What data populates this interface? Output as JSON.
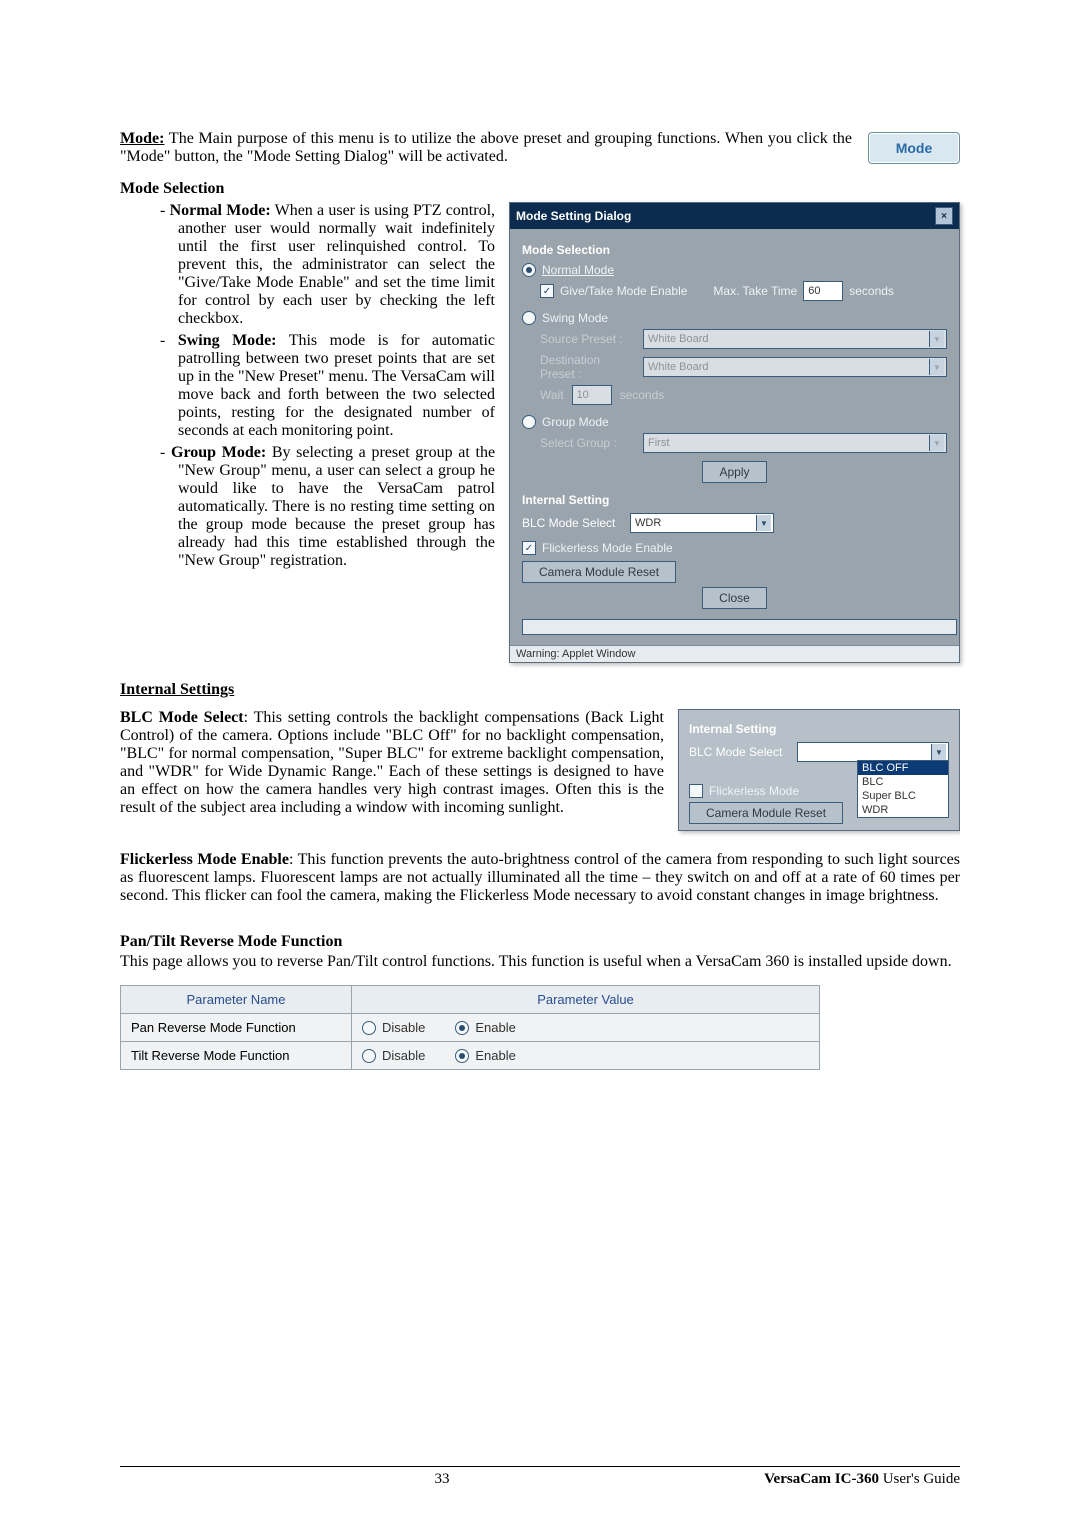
{
  "header": {
    "mode_label": "Mode:",
    "mode_paragraph": "The Main purpose of this menu is to utilize the above preset and grouping functions.   When you click the \"Mode\" button, the \"Mode Setting Dialog\" will be activated.",
    "mode_button": "Mode"
  },
  "mode_selection": {
    "title": "Mode Selection",
    "items": [
      {
        "name": "Normal Mode:",
        "text": "When a user is using PTZ control, another user would normally wait indefinitely until the first user relinquished control.  To prevent this, the administrator can select the \"Give/Take Mode Enable\" and set the time limit for control by each user by checking the left checkbox."
      },
      {
        "name": "Swing Mode:",
        "text": "This mode is for automatic patrolling between two preset points that are set up in the \"New Preset\" menu.   The VersaCam will move back and forth between the two selected points, resting for the designated number of seconds at each monitoring point."
      },
      {
        "name": "Group Mode:",
        "text": "By selecting a preset group at the \"New Group\" menu, a user can select a group he would like to have the VersaCam patrol automatically.   There is no resting time setting on the group mode because the preset group has already had this time established through the \"New Group\" registration."
      }
    ]
  },
  "dialog": {
    "title": "Mode Setting Dialog",
    "mode_selection_label": "Mode Selection",
    "normal_mode_label": "Normal Mode",
    "give_take_label": "Give/Take Mode Enable",
    "max_take_time_label": "Max. Take Time",
    "max_take_time_value": "60",
    "seconds_label": "seconds",
    "swing_mode_label": "Swing Mode",
    "source_preset_label": "Source Preset :",
    "source_preset_value": "White Board",
    "dest_preset_label": "Destination Preset :",
    "dest_preset_value": "White Board",
    "wait_label": "Wait",
    "wait_value": "10",
    "wait_seconds": "seconds",
    "group_mode_label": "Group Mode",
    "select_group_label": "Select Group :",
    "select_group_value": "First",
    "apply_label": "Apply",
    "internal_setting_label": "Internal Setting",
    "blc_mode_label": "BLC Mode Select",
    "blc_mode_value": "WDR",
    "flickerless_label": "Flickerless Mode Enable",
    "camera_reset_label": "Camera Module Reset",
    "close_label": "Close",
    "statusbar": "Warning: Applet Window"
  },
  "internal_settings": {
    "title": "Internal Settings",
    "blc": {
      "label": "BLC Mode Select",
      "text": ":   This setting controls the backlight compensations (Back Light Control) of the camera.   Options include \"BLC Off\" for no backlight compensation, \"BLC\" for normal compensation, \"Super BLC\" for extreme backlight compensation, and \"WDR\" for Wide Dynamic Range.\"   Each of these settings is designed to have an effect on how the camera handles very high contrast images.   Often this is the result of the subject area including a window with incoming sunlight."
    },
    "panel": {
      "title": "Internal Setting",
      "blc_label": "BLC Mode Select",
      "flickerless_label": "Flickerless Mode",
      "reset_label": "Camera Module Reset",
      "options": [
        "BLC OFF",
        "BLC",
        "Super BLC",
        "WDR"
      ],
      "selected": "BLC OFF"
    },
    "flickerless": {
      "label": "Flickerless Mode Enable",
      "text": ":   This function prevents the auto-brightness control of the camera from responding to such light sources as fluorescent lamps.  Fluorescent lamps are not actually illuminated all the time – they switch on and off at a rate of 60 times per second.   This flicker can fool the camera, making the Flickerless Mode necessary to avoid constant changes in image brightness."
    }
  },
  "pan_tilt": {
    "title": "Pan/Tilt Reverse Mode Function",
    "intro": "This page allows you to reverse Pan/Tilt control functions. This function is useful when a VersaCam 360 is installed upside down.",
    "table": {
      "header_name": "Parameter Name",
      "header_value": "Parameter Value",
      "rows": [
        {
          "name": "Pan Reverse Mode Function",
          "disable": "Disable",
          "enable": "Enable",
          "selected": "Enable"
        },
        {
          "name": "Tilt Reverse Mode Function",
          "disable": "Disable",
          "enable": "Enable",
          "selected": "Enable"
        }
      ]
    }
  },
  "footer": {
    "page": "33",
    "product": "VersaCam IC-360",
    "guide": " User's Guide"
  }
}
